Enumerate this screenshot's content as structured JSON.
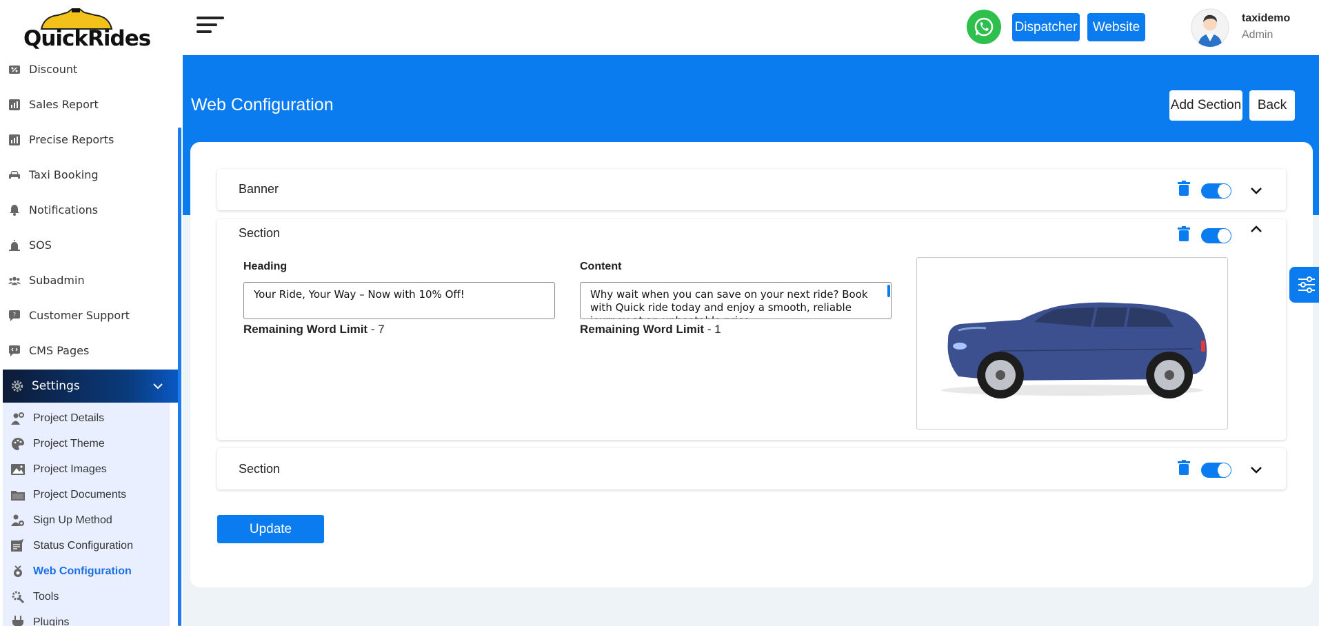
{
  "brand": {
    "name": "QuickRides"
  },
  "sidebar": {
    "items": [
      {
        "label": "Discount",
        "icon": "discount-icon"
      },
      {
        "label": "Sales Report",
        "icon": "chart-icon"
      },
      {
        "label": "Precise Reports",
        "icon": "chart-icon"
      },
      {
        "label": "Taxi Booking",
        "icon": "car-icon"
      },
      {
        "label": "Notifications",
        "icon": "bell-icon"
      },
      {
        "label": "SOS",
        "icon": "alarm-icon"
      },
      {
        "label": "Subadmin",
        "icon": "users-icon"
      },
      {
        "label": "Customer Support",
        "icon": "chat-icon"
      },
      {
        "label": "CMS Pages",
        "icon": "code-icon"
      }
    ],
    "settings_label": "Settings",
    "submenu": [
      {
        "label": "Project Details",
        "icon": "user-gear-icon"
      },
      {
        "label": "Project Theme",
        "icon": "palette-icon"
      },
      {
        "label": "Project Images",
        "icon": "image-icon"
      },
      {
        "label": "Project Documents",
        "icon": "folder-icon"
      },
      {
        "label": "Sign Up Method",
        "icon": "user-add-icon"
      },
      {
        "label": "Status Configuration",
        "icon": "status-icon"
      },
      {
        "label": "Web Configuration",
        "icon": "web-config-icon",
        "active": true
      },
      {
        "label": "Tools",
        "icon": "tools-icon"
      },
      {
        "label": "Plugins",
        "icon": "plug-icon"
      }
    ]
  },
  "topbar": {
    "dispatcher_label": "Dispatcher",
    "website_label": "Website",
    "user_name": "taxidemo",
    "user_role": "Admin"
  },
  "page": {
    "title": "Web Configuration",
    "add_section_label": "Add Section",
    "back_label": "Back"
  },
  "sections": [
    {
      "title": "Banner",
      "enabled": true,
      "expanded": false
    },
    {
      "title": "Section",
      "enabled": true,
      "expanded": true,
      "heading_label": "Heading",
      "heading_value": "Your Ride, Your Way – Now with 10% Off!",
      "heading_limit_label": "Remaining Word Limit",
      "heading_limit_value": "- 7",
      "content_label": "Content",
      "content_value": "Why wait when you can save on your next ride? Book with Quick ride today and enjoy a smooth, reliable journey at an unbeatable price.",
      "content_limit_label": "Remaining Word Limit",
      "content_limit_value": "- 1"
    },
    {
      "title": "Section",
      "enabled": true,
      "expanded": false
    }
  ],
  "update_label": "Update",
  "colors": {
    "primary": "#0a7cf0",
    "whatsapp": "#2fbf4d",
    "car_body": "#3c4f8e"
  }
}
